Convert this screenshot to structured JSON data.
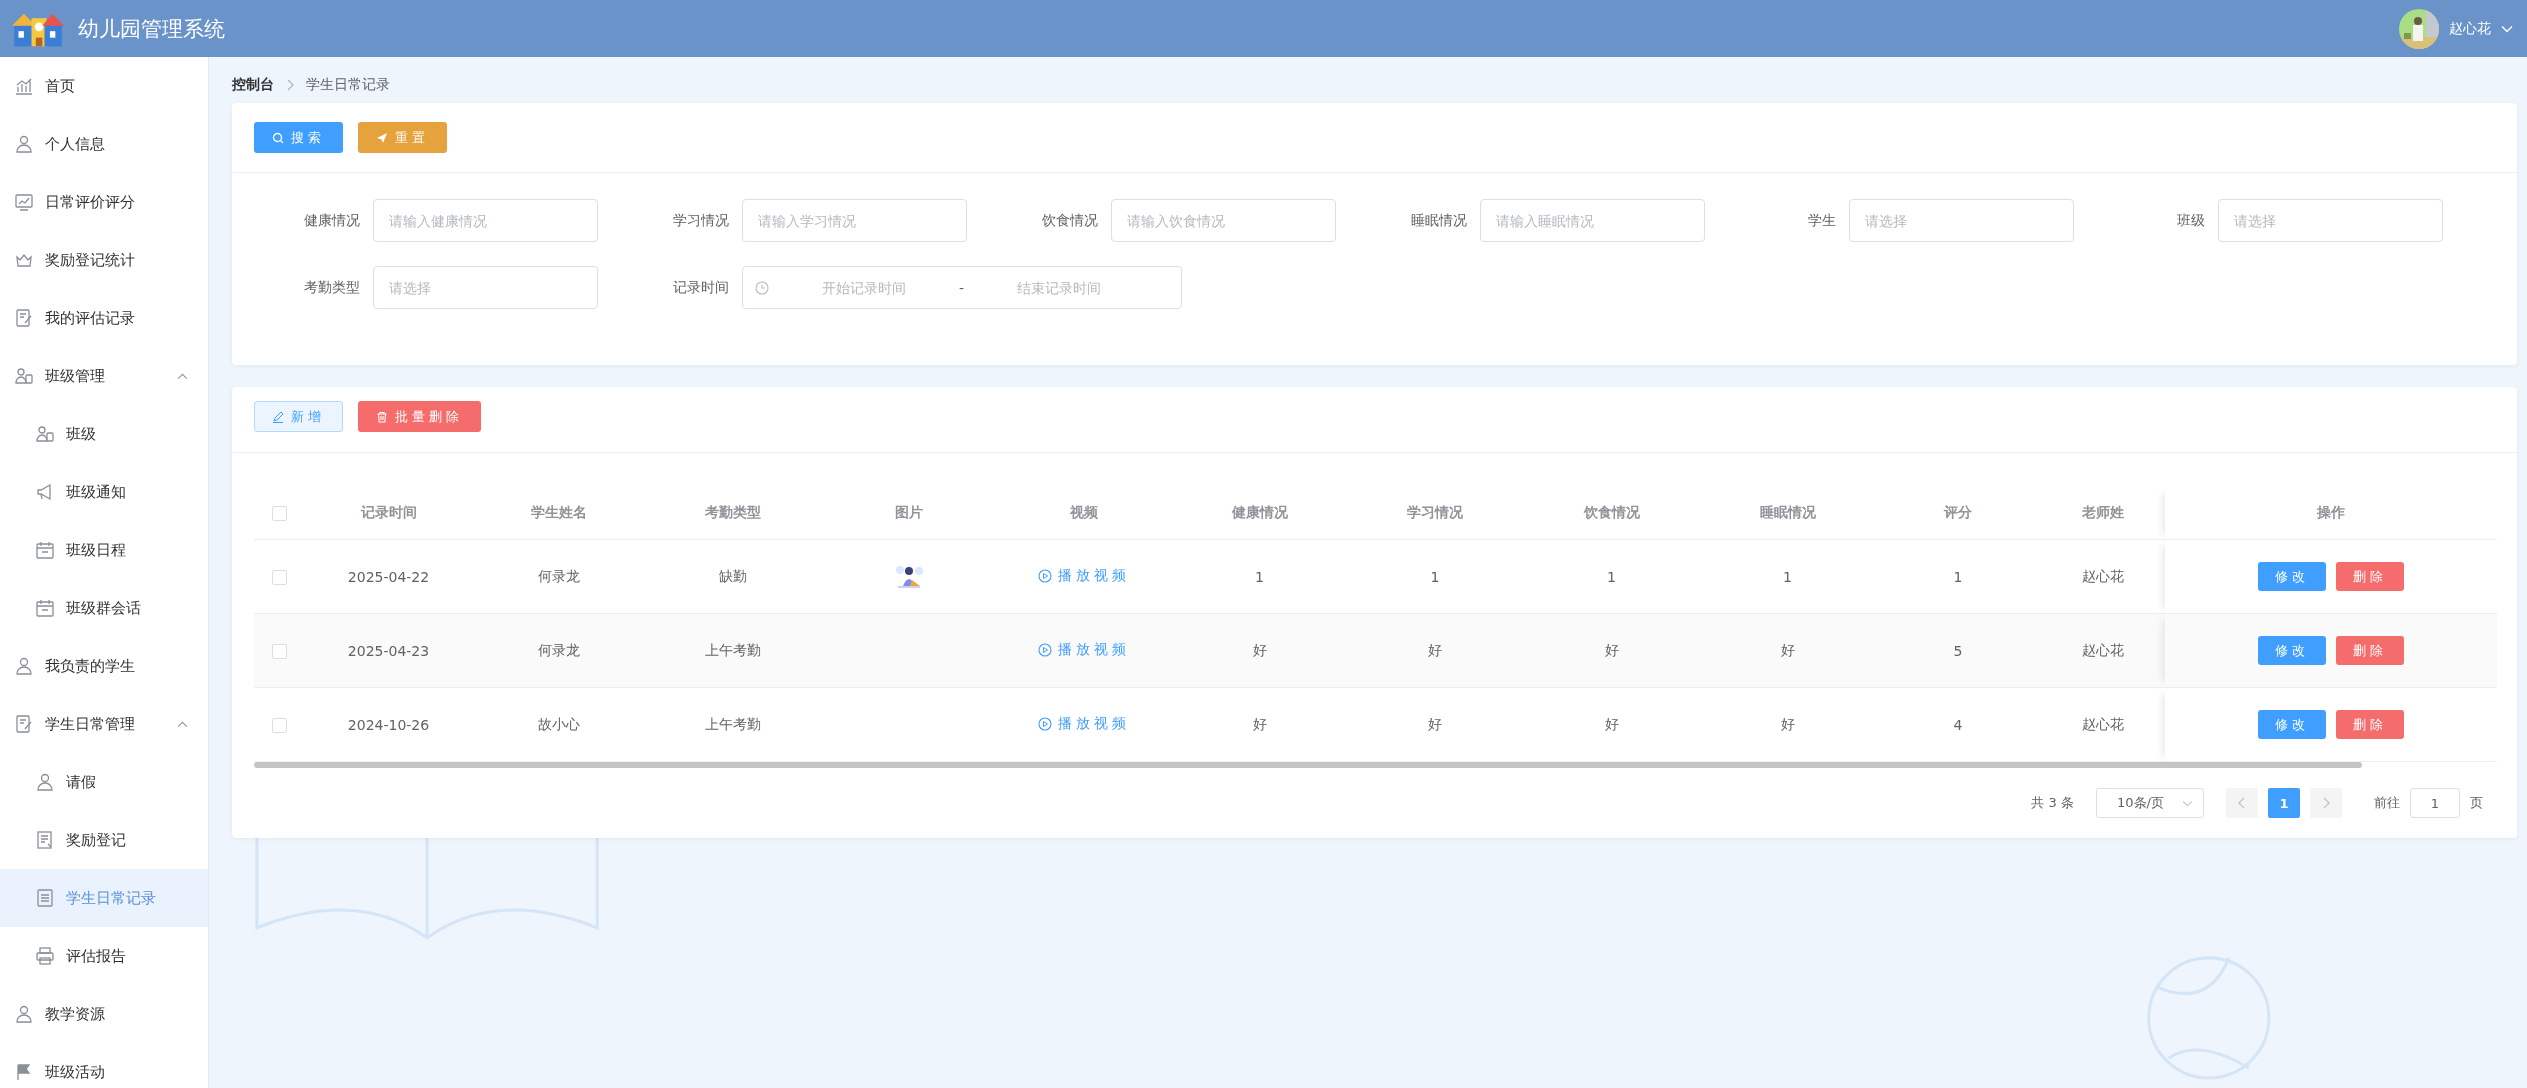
{
  "header": {
    "title": "幼儿园管理系统",
    "user_name": "赵心花"
  },
  "sidebar": {
    "items": [
      {
        "kind": "link",
        "label": "首页",
        "selected": false
      },
      {
        "kind": "link",
        "label": "个人信息",
        "selected": false
      },
      {
        "kind": "link",
        "label": "日常评价评分",
        "selected": false
      },
      {
        "kind": "link",
        "label": "奖励登记统计",
        "selected": false
      },
      {
        "kind": "link",
        "label": "我的评估记录",
        "selected": false
      },
      {
        "kind": "group",
        "label": "班级管理",
        "selected": false,
        "expanded": true,
        "children": [
          {
            "label": "班级",
            "selected": false
          },
          {
            "label": "班级通知",
            "selected": false
          },
          {
            "label": "班级日程",
            "selected": false
          },
          {
            "label": "班级群会话",
            "selected": false
          }
        ]
      },
      {
        "kind": "link",
        "label": "我负责的学生",
        "selected": false
      },
      {
        "kind": "group",
        "label": "学生日常管理",
        "selected": false,
        "expanded": true,
        "children": [
          {
            "label": "请假",
            "selected": false
          },
          {
            "label": "奖励登记",
            "selected": false
          },
          {
            "label": "学生日常记录",
            "selected": true
          },
          {
            "label": "评估报告",
            "selected": false
          }
        ]
      },
      {
        "kind": "link",
        "label": "教学资源",
        "selected": false
      },
      {
        "kind": "link",
        "label": "班级活动",
        "selected": false
      }
    ]
  },
  "breadcrumb": [
    {
      "label": "控制台",
      "current": false
    },
    {
      "label": "学生日常记录",
      "current": true
    }
  ],
  "search_bar": {
    "buttons": [
      {
        "kind": "search",
        "label": "搜索"
      },
      {
        "kind": "reset",
        "label": "重置"
      }
    ],
    "filters": [
      {
        "kind": "input",
        "label": "健康情况",
        "placeholder": "请输入健康情况"
      },
      {
        "kind": "input",
        "label": "学习情况",
        "placeholder": "请输入学习情况"
      },
      {
        "kind": "input",
        "label": "饮食情况",
        "placeholder": "请输入饮食情况"
      },
      {
        "kind": "input",
        "label": "睡眠情况",
        "placeholder": "请输入睡眠情况"
      },
      {
        "kind": "select",
        "label": "学生",
        "placeholder": "请选择"
      },
      {
        "kind": "select",
        "label": "班级",
        "placeholder": "请选择"
      },
      {
        "kind": "select",
        "label": "考勤类型",
        "placeholder": "请选择"
      },
      {
        "kind": "daterange",
        "label": "记录时间",
        "start_placeholder": "开始记录时间",
        "separator": "-",
        "end_placeholder": "结束记录时间"
      }
    ]
  },
  "table": {
    "buttons": [
      {
        "kind": "add",
        "label": "新增"
      },
      {
        "kind": "batch_delete",
        "label": "批量删除"
      }
    ],
    "header_checked": false,
    "columns": [
      "记录时间",
      "学生姓名",
      "考勤类型",
      "图片",
      "视频",
      "健康情况",
      "学习情况",
      "饮食情况",
      "睡眠情况",
      "评分",
      "老师姓",
      "操作"
    ],
    "rows": [
      {
        "checked": false,
        "record_time": "2025-04-22",
        "student": "何录龙",
        "attendance": "缺勤",
        "image": {
          "kind": "picture"
        },
        "video": "播放视频",
        "health": "1",
        "study": "1",
        "diet": "1",
        "sleep": "1",
        "score": "1",
        "teacher": "赵心花",
        "actions": [
          "修改",
          "删除"
        ]
      },
      {
        "checked": false,
        "record_time": "2025-04-23",
        "student": "何录龙",
        "attendance": "上午考勤",
        "video": "播放视频",
        "health": "好",
        "study": "好",
        "diet": "好",
        "sleep": "好",
        "score": "5",
        "teacher": "赵心花",
        "actions": [
          "修改",
          "删除"
        ]
      },
      {
        "checked": false,
        "record_time": "2024-10-26",
        "student": "故小心",
        "attendance": "上午考勤",
        "video": "播放视频",
        "health": "好",
        "study": "好",
        "diet": "好",
        "sleep": "好",
        "score": "4",
        "teacher": "赵心花",
        "actions": [
          "修改",
          "删除"
        ]
      }
    ]
  },
  "pagination": {
    "total": "共 3 条",
    "page_size": "10条/页",
    "pages": [
      {
        "label": "1",
        "selected": true
      }
    ],
    "goto_label": "前往",
    "goto_value": "1",
    "goto_suffix": "页"
  }
}
